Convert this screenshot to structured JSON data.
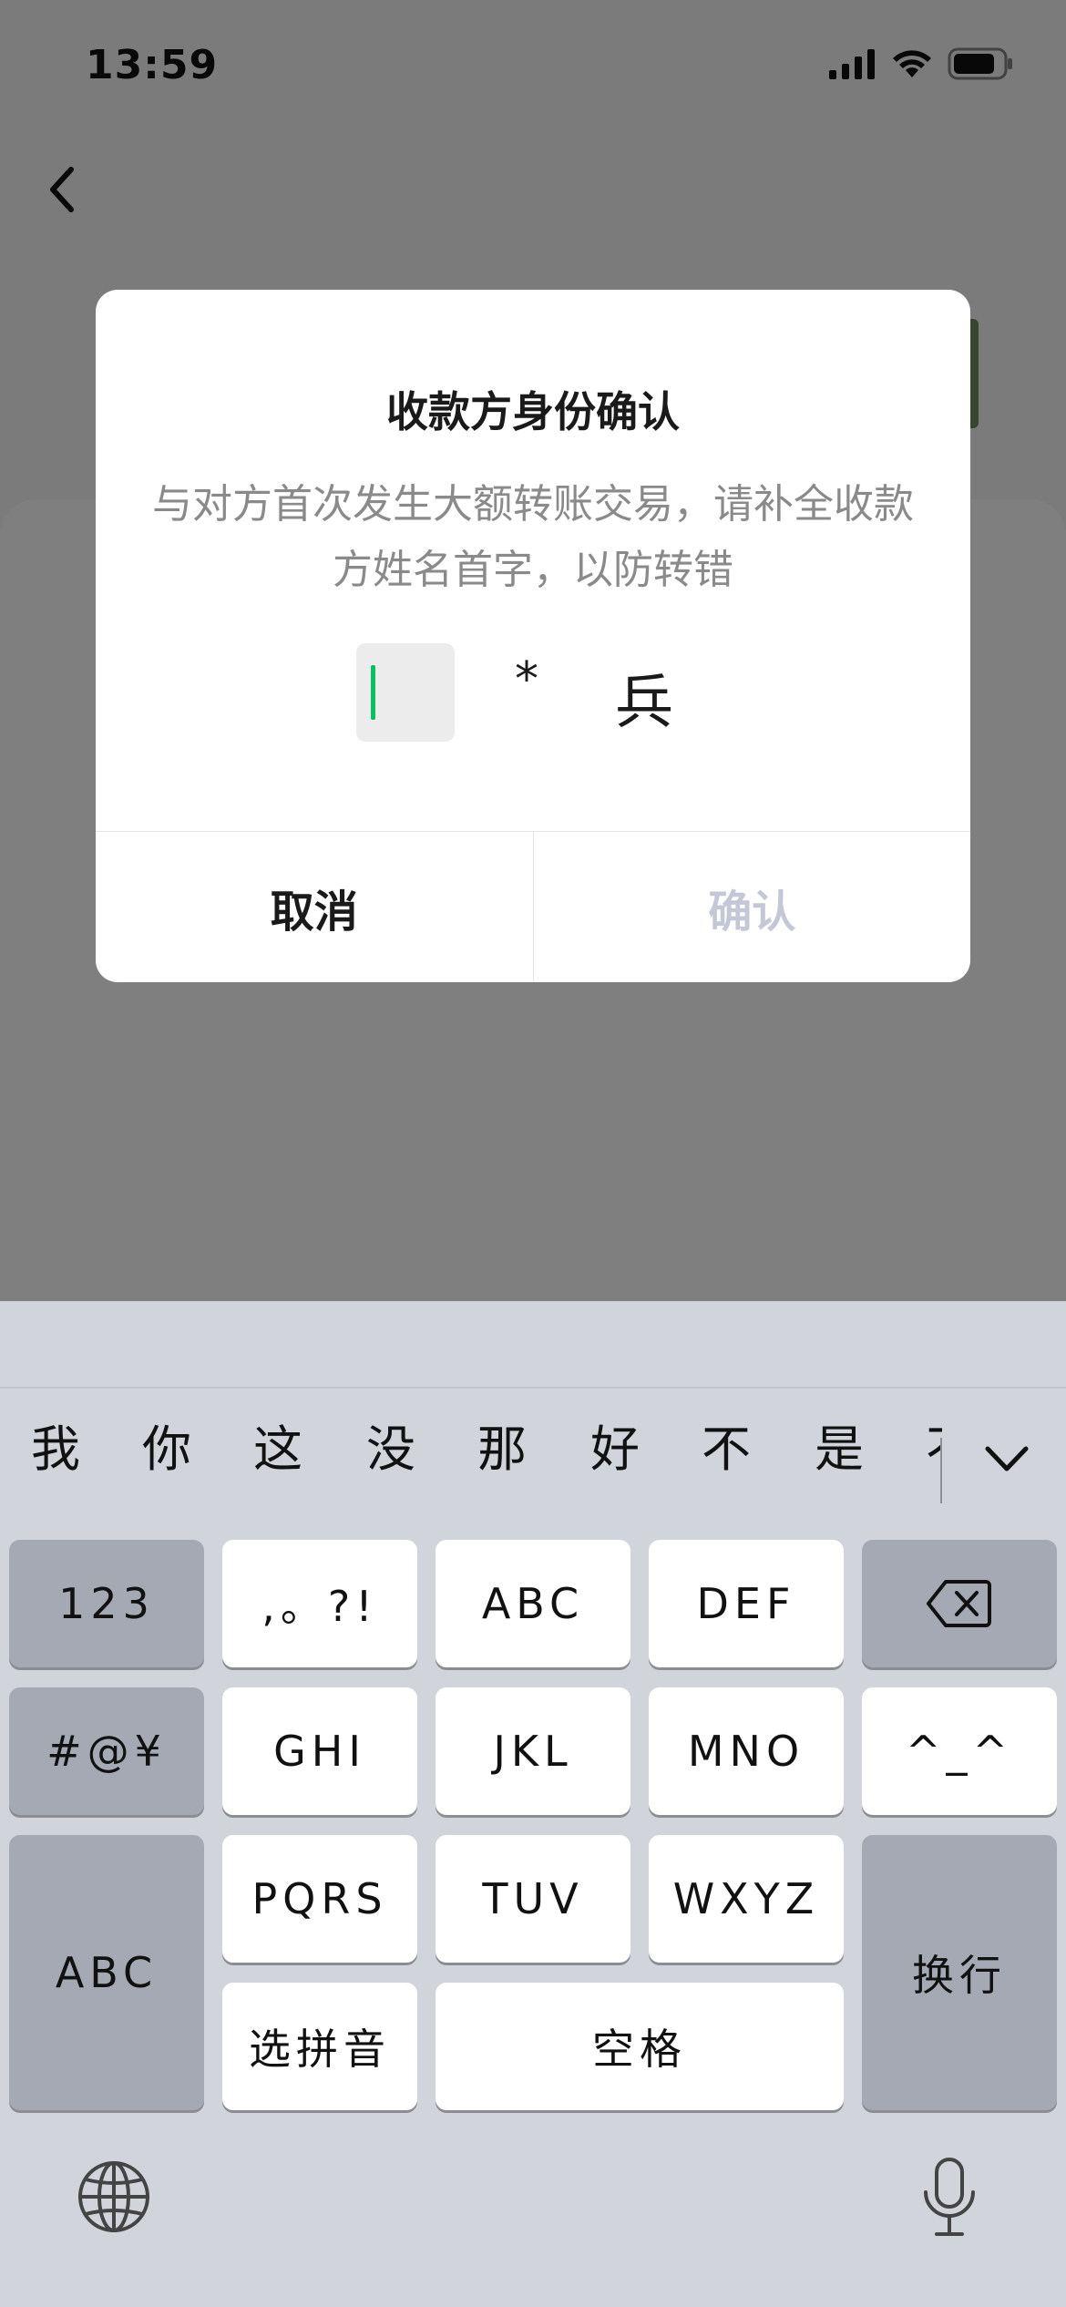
{
  "status_bar": {
    "time": "13:59"
  },
  "dialog": {
    "title": "收款方身份确认",
    "description": "与对方首次发生大额转账交易，请补全收款方姓名首字，以防转错",
    "name_mask": "*",
    "name_last_char": "兵",
    "cancel_label": "取消",
    "confirm_label": "确认"
  },
  "keyboard": {
    "candidates": [
      "我",
      "你",
      "这",
      "没",
      "那",
      "好",
      "不",
      "是",
      "不"
    ],
    "keys": {
      "num": "123",
      "punct": ",。?!",
      "abc": "ABC",
      "def": "DEF",
      "symbols": "#@¥",
      "ghi": "GHI",
      "jkl": "JKL",
      "mno": "MNO",
      "emoticon": "^_^",
      "abc_switch": "ABC",
      "pqrs": "PQRS",
      "tuv": "TUV",
      "wxyz": "WXYZ",
      "newline": "换行",
      "pinyin_select": "选拼音",
      "space": "空格"
    }
  },
  "icons": [
    "back-chevron-icon",
    "signal-icon",
    "wifi-icon",
    "battery-icon",
    "backspace-icon",
    "chevron-down-icon",
    "globe-icon",
    "microphone-icon"
  ]
}
